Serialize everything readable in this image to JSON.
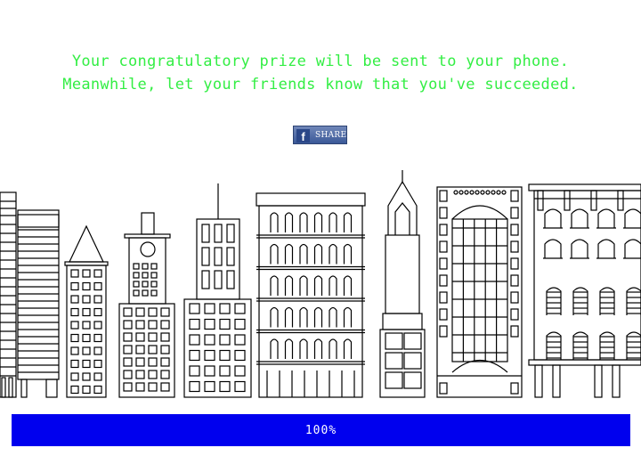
{
  "message": {
    "line1": "Your congratulatory prize will be sent to your phone.",
    "line2": "Meanwhile, let your friends know that you've succeeded."
  },
  "share_button": {
    "icon_glyph": "f",
    "label": "SHARE",
    "color": "#3b5998"
  },
  "progress": {
    "value": 100,
    "label": "100%",
    "color": "#0000ee"
  },
  "colors": {
    "message": "#33ee44",
    "city_stroke": "#000000"
  }
}
